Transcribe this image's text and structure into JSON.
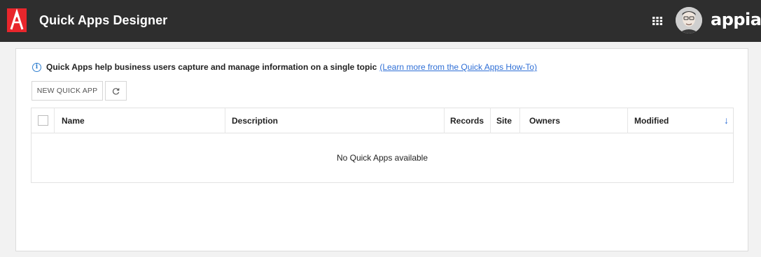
{
  "header": {
    "logo_icon": "appian-a-logo-icon",
    "title": "Quick Apps Designer",
    "apps_icon": "apps-grid-icon",
    "avatar_icon": "user-avatar-icon",
    "brand": "appian",
    "bar_color": "#2e2e2e",
    "logo_color": "#e8262c"
  },
  "main": {
    "info_icon": "info-circle-icon",
    "info_text": "Quick Apps help business users capture and manage information on a single topic",
    "info_link": "(Learn more from the Quick Apps How-To)",
    "new_button": "NEW QUICK APP",
    "refresh_icon": "refresh-icon",
    "table": {
      "columns": [
        "Name",
        "Description",
        "Records",
        "Site",
        "Owners",
        "Modified"
      ],
      "sort_icon": "sort-down-arrow-icon",
      "empty_message": "No Quick Apps available"
    },
    "link_color": "#2f6fd6"
  }
}
